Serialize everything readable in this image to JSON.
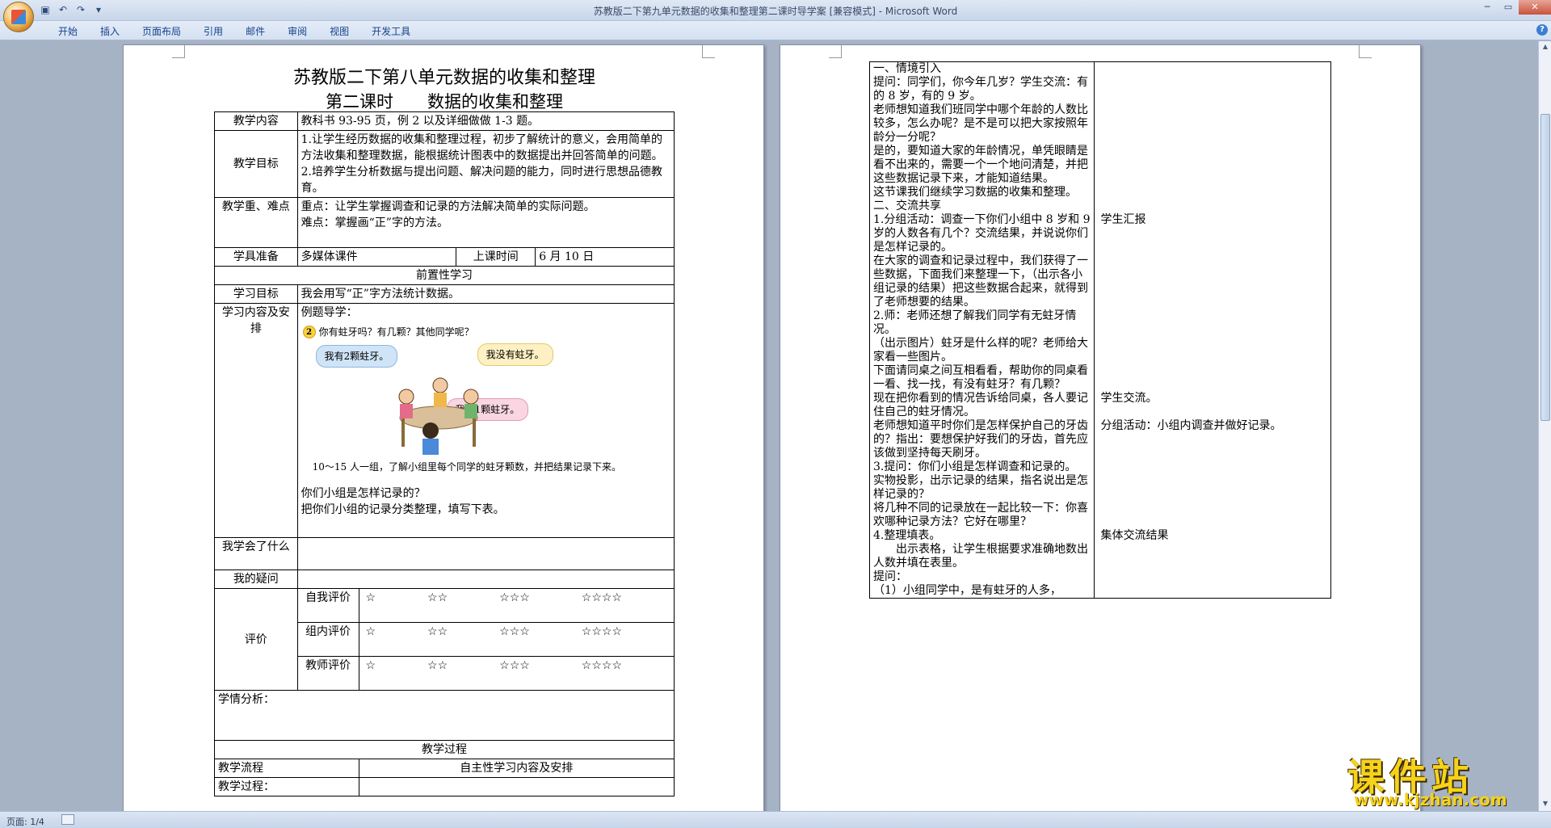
{
  "window": {
    "title": "苏教版二下第九单元数据的收集和整理第二课时导学案 [兼容模式] - Microsoft Word"
  },
  "ribbon": {
    "tabs": [
      "开始",
      "插入",
      "页面布局",
      "引用",
      "邮件",
      "审阅",
      "视图",
      "开发工具"
    ]
  },
  "status": {
    "page_count": "页面: 1/4"
  },
  "page1": {
    "title1": "苏教版二下第八单元数据的收集和整理",
    "title2": "第二课时　　数据的收集和整理",
    "rows": {
      "content_label": "教学内容",
      "content_value": "教科书 93-95 页，例 2 以及详细做做 1-3 题。",
      "goal_label": "教学目标",
      "goal_1": "1.让学生经历数据的收集和整理过程，初步了解统计的意义，会用简单的方法收集和整理数据，能根据统计图表中的数据提出并回答简单的问题。",
      "goal_2": "2.培养学生分析数据与提出问题、解决问题的能力，同时进行思想品德教育。",
      "key_label": "教学重、难点",
      "key_1": "重点：让学生掌握调查和记录的方法解决简单的实际问题。",
      "key_2": "难点：掌握画“正”字的方法。",
      "prep_label": "学具准备",
      "prep_value": "多媒体课件",
      "time_label": "上课时间",
      "time_value": "6 月 10 日",
      "pre_study": "前置性学习",
      "study_goal_label": "学习目标",
      "study_goal_value": "我会用写“正”字方法统计数据。",
      "arrange_label": "学习内容及安排",
      "example": "例题导学：",
      "question": "你有蛀牙吗？有几颗？其他同学呢？",
      "bubble_1": "我有2颗蛀牙。",
      "bubble_2": "我没有蛀牙。",
      "bubble_3": "我有1颗蛀牙。",
      "caption": "10～15 人一组，了解小组里每个同学的蛀牙颗数，并把结果记录下来。",
      "ask_1": "你们小组是怎样记录的？",
      "ask_2": "把你们小组的记录分类整理，填写下表。",
      "learned_label": "我学会了什么",
      "doubt_label": "我的疑问",
      "eval_label": "评价",
      "self_eval": "自我评价",
      "group_eval": "组内评价",
      "teacher_eval": "教师评价",
      "stars": [
        "☆",
        "☆☆",
        "☆☆☆",
        "☆☆☆☆"
      ],
      "analysis_label": "学情分析：",
      "process_header": "教学过程",
      "flow_label": "教学流程",
      "self_study_label": "自主性学习内容及安排",
      "process_label": "教学过程："
    }
  },
  "page2": {
    "rows": [
      {
        "left": "一、情境引入",
        "right": ""
      },
      {
        "left": "提问：同学们，你今年几岁？学生交流：有的 8 岁，有的 9 岁。",
        "right": ""
      },
      {
        "left": "老师想知道我们班同学中哪个年龄的人数比较多，怎么办呢？是不是可以把大家按照年龄分一分呢？",
        "right": ""
      },
      {
        "left": "是的，要知道大家的年龄情况，单凭眼睛是看不出来的，需要一个一个地问清楚，并把这些数据记录下来，才能知道结果。",
        "right": ""
      },
      {
        "left": "这节课我们继续学习数据的收集和整理。",
        "right": ""
      },
      {
        "left": "二、交流共享",
        "right": ""
      },
      {
        "left": "1.分组活动：调查一下你们小组中 8 岁和 9 岁的人数各有几个？交流结果，并说说你们是怎样记录的。",
        "right": "学生汇报"
      },
      {
        "left": "在大家的调查和记录过程中，我们获得了一些数据，下面我们来整理一下，（出示各小组记录的结果）把这些数据合起来，就得到了老师想要的结果。",
        "right": ""
      },
      {
        "left": "2.师：老师还想了解我们同学有无蛀牙情况。",
        "right": ""
      },
      {
        "left": "（出示图片）蛀牙是什么样的呢？老师给大家看一些图片。",
        "right": ""
      },
      {
        "left": "下面请同桌之间互相看看，帮助你的同桌看一看、找一找，有没有蛀牙？有几颗？",
        "right": ""
      },
      {
        "left": "现在把你看到的情况告诉给同桌，各人要记住自己的蛀牙情况。",
        "right": "学生交流。"
      },
      {
        "left": "老师想知道平时你们是怎样保护自己的牙齿的？指出：要想保护好我们的牙齿，首先应该做到坚持每天刷牙。",
        "right": "分组活动：小组内调查并做好记录。"
      },
      {
        "left": "3.提问：你们小组是怎样调查和记录的。",
        "right": ""
      },
      {
        "left": "实物投影，出示记录的结果，指名说出是怎样记录的？",
        "right": ""
      },
      {
        "left": "将几种不同的记录放在一起比较一下：你喜欢哪种记录方法？它好在哪里？",
        "right": ""
      },
      {
        "left": "4.整理填表。",
        "right": "集体交流结果"
      },
      {
        "left": "　　出示表格，让学生根据要求准确地数出人数并填在表里。",
        "right": ""
      },
      {
        "left": "提问：",
        "right": ""
      },
      {
        "left": "（1）小组同学中，是有蛀牙的人多，",
        "right": ""
      }
    ]
  },
  "watermark": {
    "main": "课件站",
    "url": "www.kjzhan.com"
  }
}
